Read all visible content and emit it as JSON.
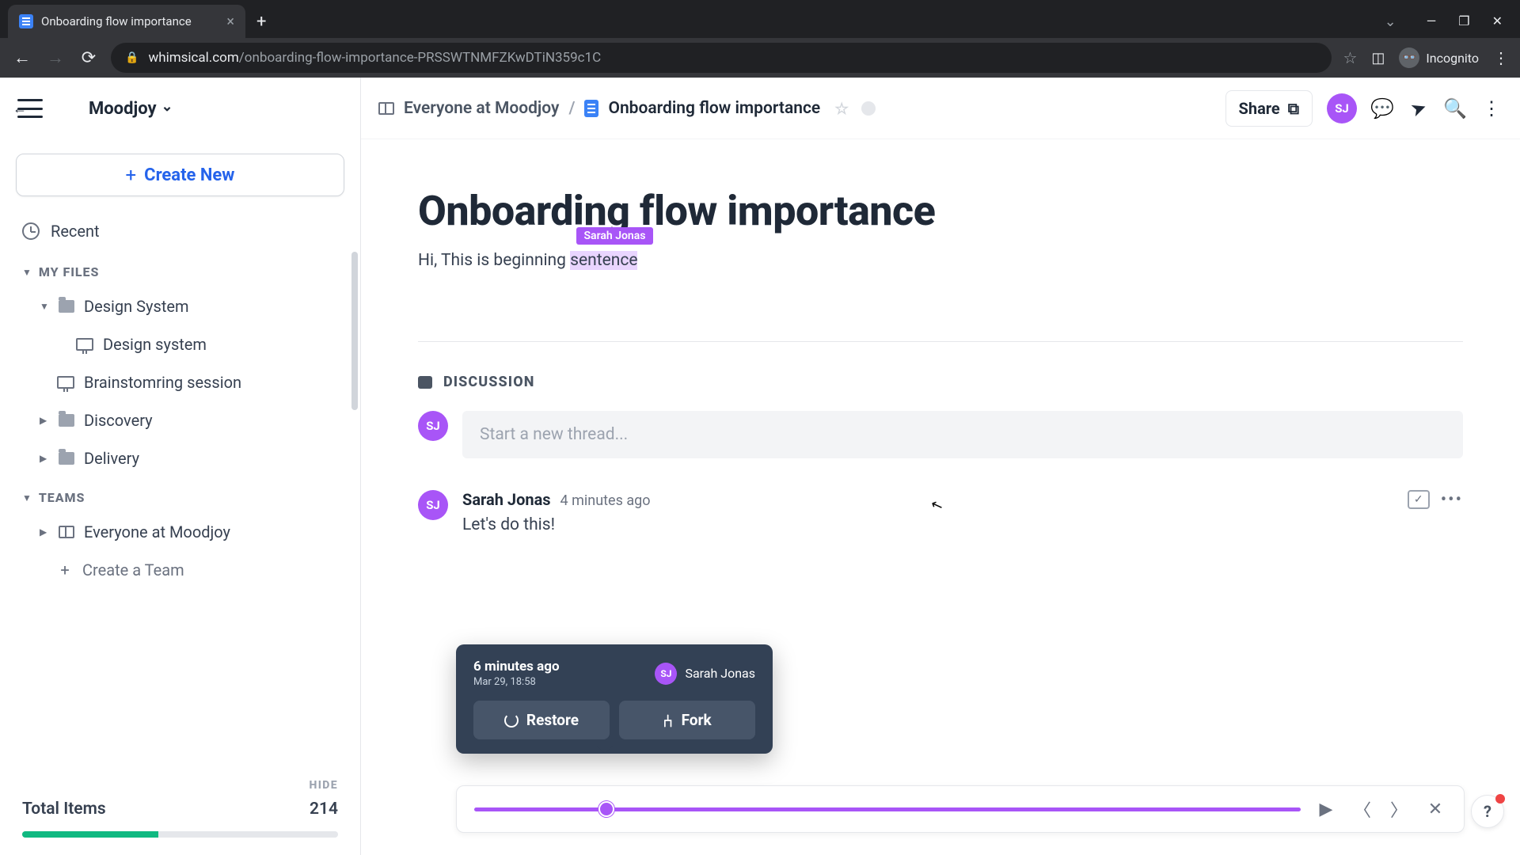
{
  "browser": {
    "tab_title": "Onboarding flow importance",
    "url_domain": "whimsical.com",
    "url_path": "/onboarding-flow-importance-PRSSWTNMFZKwDTiN359c1C",
    "incognito_label": "Incognito"
  },
  "sidebar": {
    "workspace": "Moodjoy",
    "create_label": "Create New",
    "recent_label": "Recent",
    "section_my_files": "MY FILES",
    "section_teams": "TEAMS",
    "folders": {
      "design_system": "Design System",
      "design_system_child": "Design system",
      "brainstorming": "Brainstomring session",
      "discovery": "Discovery",
      "delivery": "Delivery"
    },
    "teams": {
      "everyone": "Everyone at Moodjoy",
      "create_team": "Create a Team"
    },
    "hide_label": "HIDE",
    "total_label": "Total Items",
    "total_value": "214"
  },
  "header": {
    "breadcrumb_root": "Everyone at Moodjoy",
    "breadcrumb_doc": "Onboarding flow importance",
    "share_label": "Share",
    "avatar_initials": "SJ"
  },
  "document": {
    "title": "Onboarding flow importance",
    "body_pre": "Hi, This is beginning ",
    "body_sel": "sentence",
    "cursor_user": "Sarah Jonas"
  },
  "discussion": {
    "heading": "DISCUSSION",
    "placeholder": "Start a new thread...",
    "comment": {
      "avatar": "SJ",
      "author": "Sarah Jonas",
      "time": "4 minutes ago",
      "text": "Let's do this!"
    }
  },
  "history": {
    "time_rel": "6 minutes ago",
    "time_abs": "Mar 29, 18:58",
    "user_avatar": "SJ",
    "user_name": "Sarah Jonas",
    "restore_label": "Restore",
    "fork_label": "Fork"
  }
}
